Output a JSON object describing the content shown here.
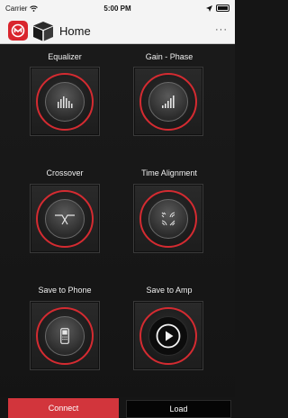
{
  "status_bar": {
    "carrier": "Carrier",
    "time": "5:00 PM"
  },
  "nav": {
    "title": "Home",
    "more": "···"
  },
  "tiles": [
    {
      "label": "Equalizer",
      "icon": "equalizer-icon"
    },
    {
      "label": "Gain - Phase",
      "icon": "gain-phase-icon"
    },
    {
      "label": "Crossover",
      "icon": "crossover-icon"
    },
    {
      "label": "Time Alignment",
      "icon": "time-alignment-icon"
    },
    {
      "label": "Save to Phone",
      "icon": "phone-icon"
    },
    {
      "label": "Save to Amp",
      "icon": "play-icon"
    }
  ],
  "bottom": {
    "connect_label": "Connect",
    "load_label": "Load"
  },
  "colors": {
    "accent": "#d42b31",
    "connect": "#d2353c",
    "background": "#151515"
  }
}
